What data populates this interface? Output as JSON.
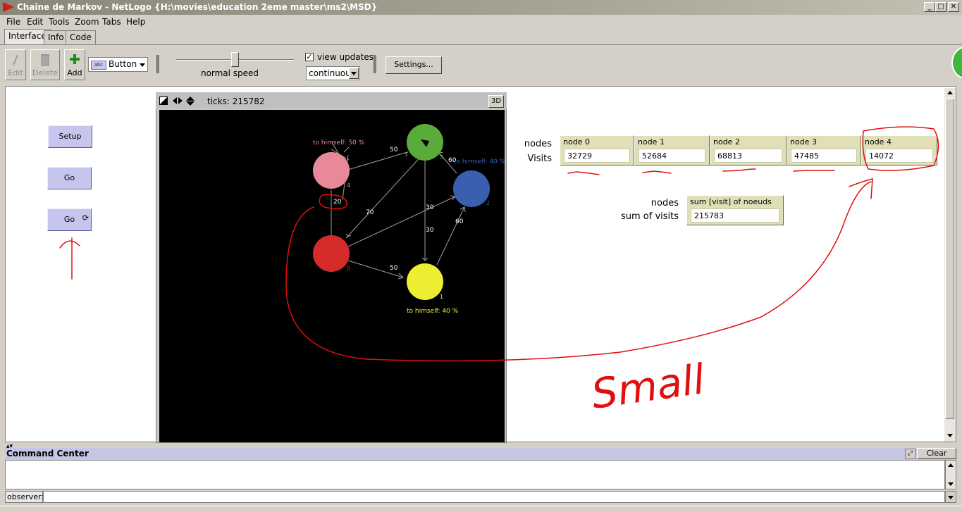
{
  "window": {
    "title": "Chaîne de Markov - NetLogo {H:\\movies\\education 2eme master\\ms2\\MSD}"
  },
  "menu": [
    "File",
    "Edit",
    "Tools",
    "Zoom",
    "Tabs",
    "Help"
  ],
  "tabs": [
    "Interface",
    "Info",
    "Code"
  ],
  "toolbar": {
    "edit": "Edit",
    "delete": "Delete",
    "add": "Add",
    "widget_type": "Button",
    "widget_chip": "abc",
    "speed_label": "normal speed",
    "speed_fraction": 0.5,
    "view_updates_label": "view updates",
    "view_updates_checked": true,
    "update_mode": "continuous",
    "settings_label": "Settings..."
  },
  "buttons": {
    "setup": "Setup",
    "go_once": "Go",
    "go_forever": "Go"
  },
  "view": {
    "ticks_label": "ticks: 215782",
    "btn_3d": "3D"
  },
  "graph": {
    "nodes": [
      {
        "id": "0",
        "label": "0",
        "color": "#d62b2b"
      },
      {
        "id": "1",
        "label": "1",
        "color": "#eded32"
      },
      {
        "id": "2",
        "label": "2",
        "color": "#3a5fae"
      },
      {
        "id": "3",
        "label": "3",
        "color": "#5aac3a"
      },
      {
        "id": "4",
        "label": "4",
        "color": "#e8899a"
      }
    ],
    "edge_labels": {
      "e4_3": "50",
      "e3_2": "60",
      "e4_0": "20",
      "e3_0": "70",
      "e0_2": "30",
      "e3_1": "30",
      "e0_1": "50",
      "e1_2": "60"
    },
    "self_labels": {
      "n4": "to himself: 50 %",
      "n2": "to himself: 40 %",
      "n1": "to himself: 40 %"
    }
  },
  "monitors": {
    "row_label_top": "nodes",
    "row_label_bottom": "Visits",
    "items": [
      {
        "label": "node 0",
        "value": "32729"
      },
      {
        "label": "node 1",
        "value": "52684"
      },
      {
        "label": "node 2",
        "value": "68813"
      },
      {
        "label": "node 3",
        "value": "47485"
      },
      {
        "label": "node 4",
        "value": "14072"
      }
    ],
    "sum_label_top": "nodes",
    "sum_label_bottom": "sum of visits",
    "sum_title": "sum [visit] of noeuds",
    "sum_value": "215783"
  },
  "annotation": {
    "text": "Small",
    "color": "#e01010"
  },
  "command_center": {
    "title": "Command Center",
    "clear": "Clear",
    "observer": "observer>",
    "input": ""
  }
}
